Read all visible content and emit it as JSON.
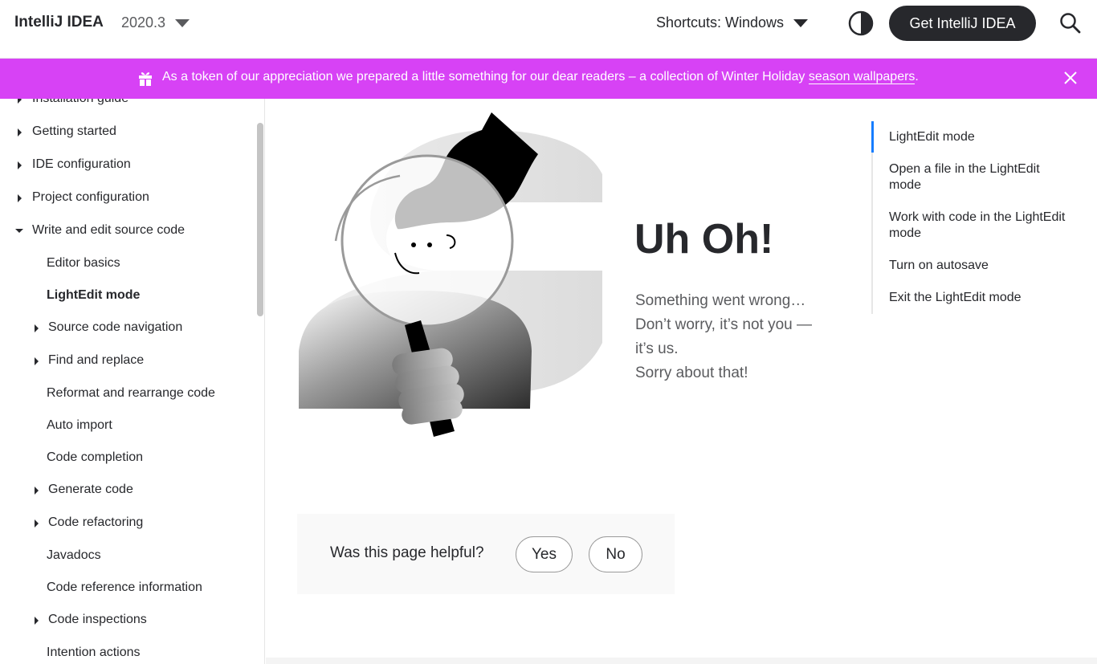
{
  "header": {
    "product_name": "IntelliJ IDEA",
    "version": "2020.3",
    "shortcuts_label": "Shortcuts: Windows",
    "get_button": "Get IntelliJ IDEA",
    "theme_icon": "contrast-icon",
    "search_icon": "search-icon"
  },
  "banner": {
    "text": "As a token of our appreciation we prepared a little something for our dear readers – a collection of Winter Holiday",
    "link": "season wallpapers",
    "suffix": ".",
    "color": "#d742f5",
    "gift_icon": "gift-icon",
    "close_icon": "close-icon"
  },
  "sidebar": {
    "items": [
      {
        "label": "Installation guide",
        "state": "collapsed"
      },
      {
        "label": "Getting started",
        "state": "collapsed"
      },
      {
        "label": "IDE configuration",
        "state": "collapsed"
      },
      {
        "label": "Project configuration",
        "state": "collapsed"
      },
      {
        "label": "Write and edit source code",
        "state": "expanded"
      },
      {
        "label": "Editor basics",
        "state": "leaf"
      },
      {
        "label": "LightEdit mode",
        "state": "active"
      },
      {
        "label": "Source code navigation",
        "state": "collapsed"
      },
      {
        "label": "Find and replace",
        "state": "collapsed"
      },
      {
        "label": "Reformat and rearrange code",
        "state": "leaf"
      },
      {
        "label": "Auto import",
        "state": "leaf"
      },
      {
        "label": "Code completion",
        "state": "leaf"
      },
      {
        "label": "Generate code",
        "state": "collapsed"
      },
      {
        "label": "Code refactoring",
        "state": "collapsed"
      },
      {
        "label": "Javadocs",
        "state": "leaf"
      },
      {
        "label": "Code reference information",
        "state": "leaf"
      },
      {
        "label": "Code inspections",
        "state": "collapsed"
      },
      {
        "label": "Intention actions",
        "state": "leaf"
      }
    ]
  },
  "main": {
    "title": "Uh Oh!",
    "message_lines": [
      "Something went wrong…",
      "Don’t worry, it’s not you —",
      "it’s us.",
      "Sorry about that!"
    ]
  },
  "feedback": {
    "question": "Was this page helpful?",
    "yes": "Yes",
    "no": "No"
  },
  "toc": {
    "items": [
      "LightEdit mode",
      "Open a file in the LightEdit mode",
      "Work with code in the LightEdit mode",
      "Turn on autosave",
      "Exit the LightEdit mode"
    ],
    "active_color": "#167dff"
  }
}
